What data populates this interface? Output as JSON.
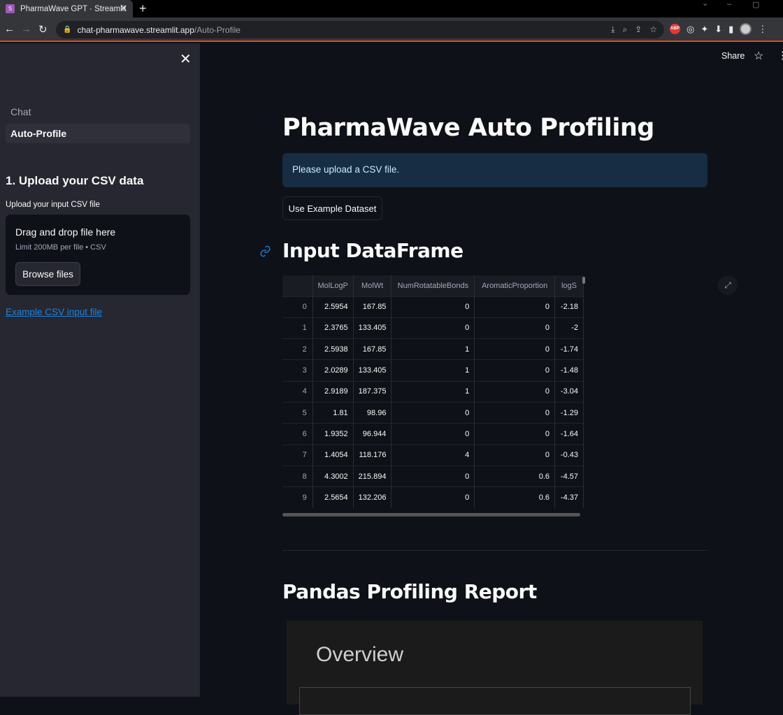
{
  "browser": {
    "tab_title": "PharmaWave GPT · Streamlit",
    "tab_close": "✕",
    "new_tab": "+",
    "url_host": "chat-pharmawave.streamlit.app",
    "url_path": "/Auto-Profile",
    "icons": [
      "install-icon",
      "zoom-icon",
      "share-icon",
      "bookmark-star-icon",
      "adblock-icon",
      "extension-icon",
      "puzzle-icon",
      "download-icon",
      "sidepanel-icon",
      "profile-avatar-icon"
    ],
    "abp_label": "ABP"
  },
  "sidebar": {
    "close_glyph": "✕",
    "nav": [
      {
        "label": "Chat",
        "active": false
      },
      {
        "label": "Auto-Profile",
        "active": true
      }
    ],
    "upload_heading": "1. Upload your CSV data",
    "upload_label": "Upload your input CSV file",
    "dropzone_title": "Drag and drop file here",
    "dropzone_limit": "Limit 200MB per file • CSV",
    "browse_label": "Browse files",
    "example_link": "Example CSV input file"
  },
  "toolbar": {
    "share_label": "Share"
  },
  "main": {
    "title": "PharmaWave Auto Profiling",
    "info_message": "Please upload a CSV file.",
    "example_button": "Use Example Dataset",
    "dataframe_heading": "Input DataFrame",
    "profiling_heading": "Pandas Profiling Report",
    "report_overview": "Overview"
  },
  "dataframe": {
    "columns": [
      "",
      "MolLogP",
      "MolWt",
      "NumRotatableBonds",
      "AromaticProportion",
      "logS"
    ],
    "rows": [
      [
        "0",
        "2.5954",
        "167.85",
        "0",
        "0",
        "-2.18"
      ],
      [
        "1",
        "2.3765",
        "133.405",
        "0",
        "0",
        "-2"
      ],
      [
        "2",
        "2.5938",
        "167.85",
        "1",
        "0",
        "-1.74"
      ],
      [
        "3",
        "2.0289",
        "133.405",
        "1",
        "0",
        "-1.48"
      ],
      [
        "4",
        "2.9189",
        "187.375",
        "1",
        "0",
        "-3.04"
      ],
      [
        "5",
        "1.81",
        "98.96",
        "0",
        "0",
        "-1.29"
      ],
      [
        "6",
        "1.9352",
        "96.944",
        "0",
        "0",
        "-1.64"
      ],
      [
        "7",
        "1.4054",
        "118.176",
        "4",
        "0",
        "-0.43"
      ],
      [
        "8",
        "4.3002",
        "215.894",
        "0",
        "0.6",
        "-4.57"
      ],
      [
        "9",
        "2.5654",
        "132.206",
        "0",
        "0.6",
        "-4.37"
      ]
    ]
  },
  "colors": {
    "app_bg": "#0e1117",
    "sidebar_bg": "#262730",
    "info_bg": "#172d43",
    "link": "#1c83e1"
  }
}
